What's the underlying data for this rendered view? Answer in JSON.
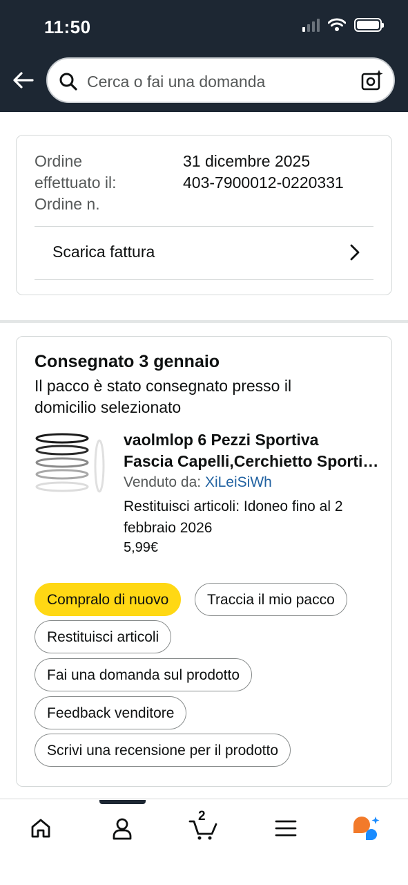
{
  "status_bar": {
    "time": "11:50"
  },
  "search": {
    "placeholder": "Cerca o fai una domanda"
  },
  "order_info": {
    "labels": [
      "Ordine",
      "effettuato il:",
      "Ordine n."
    ],
    "values": [
      "31 dicembre 2025",
      "403-7900012-0220331"
    ],
    "invoice_label": "Scarica fattura"
  },
  "shipment": {
    "status_title": "Consegnato 3 gennaio",
    "status_description": "Il pacco è stato consegnato presso il domicilio selezionato",
    "product": {
      "title_line1": "vaolmlop 6 Pezzi Sportiva",
      "title_line2": "Fascia Capelli,Cerchietto Sportivo",
      "sold_by_label": "Venduto da:",
      "seller": "XiLeiSiWh",
      "returns_text": "Restituisci articoli: Idoneo fino al 2 febbraio 2026",
      "price": "5,99€"
    },
    "actions": {
      "buy_again": "Compralo di nuovo",
      "track": "Traccia il mio pacco",
      "return": "Restituisci articoli",
      "ask": "Fai una domanda sul prodotto",
      "seller_feedback": "Feedback venditore",
      "review": "Scrivi una recensione per il prodotto"
    }
  },
  "tab_bar": {
    "cart_count": "2",
    "tabs": [
      "home-icon",
      "account-icon",
      "cart-icon",
      "menu-icon",
      "rufus-assistant-icon"
    ]
  },
  "colors": {
    "header_bg": "#1d2733",
    "primary_button": "#ffd814",
    "link": "#2162a1"
  }
}
